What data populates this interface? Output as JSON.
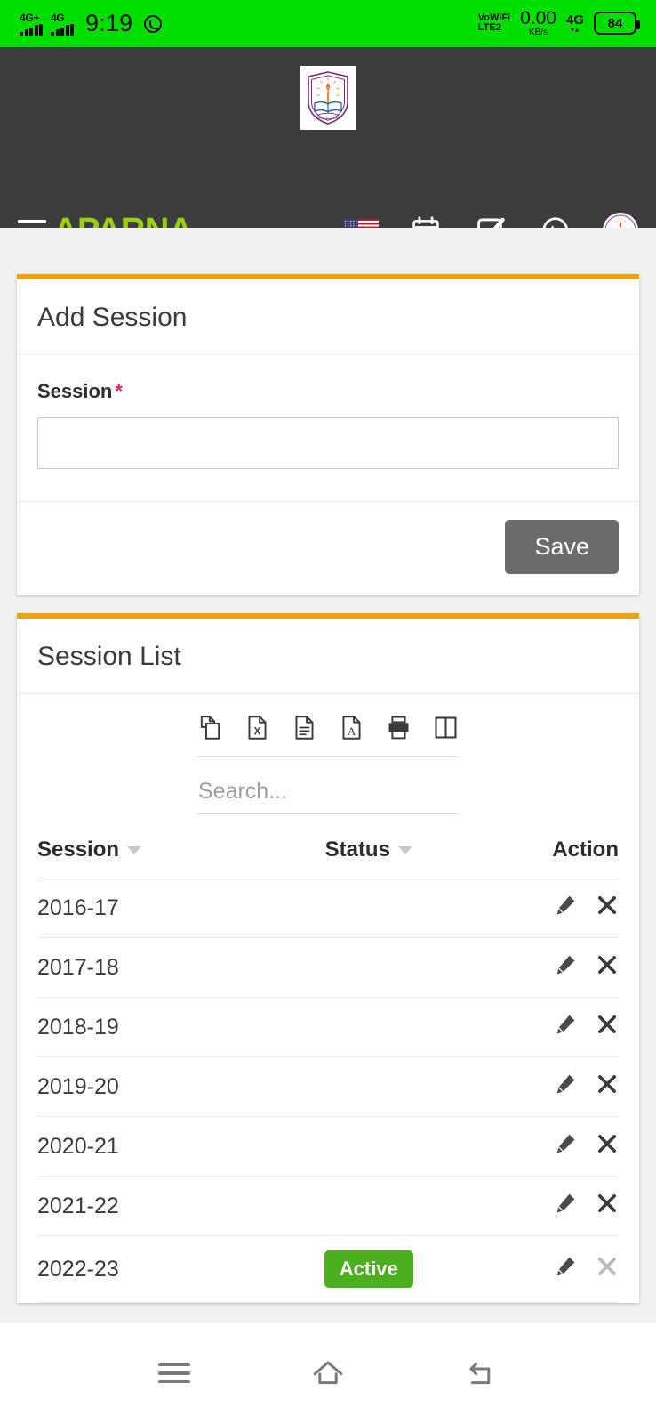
{
  "statusbar": {
    "network_1_label": "4G+",
    "network_2_label": "4G",
    "time": "9:19",
    "whatsapp_icon": "whatsapp-icon",
    "volte_line1": "VoWiFi",
    "volte_line2": "LTE2",
    "data_rate": "0.00",
    "data_rate_unit": "KB/s",
    "network_3_label": "4G",
    "battery_level": "84"
  },
  "header": {
    "brand_title": "APARNA  ...",
    "brand_color": "#9ace12",
    "background_color": "#3d3d3d",
    "menu_icon": "hamburger-menu-icon",
    "logo_alt": "school-crest-logo",
    "nav_icons": [
      {
        "name": "language-flag-icon",
        "label": "US Flag"
      },
      {
        "name": "calendar-icon",
        "label": "Calendar"
      },
      {
        "name": "task-checkbox-icon",
        "label": "Tasks"
      },
      {
        "name": "whatsapp-icon",
        "label": "WhatsApp"
      },
      {
        "name": "user-avatar-icon",
        "label": "Profile"
      }
    ]
  },
  "add_session_card": {
    "accent_color": "#f0a30a",
    "title": "Add Session",
    "field_label": "Session",
    "required_marker": "*",
    "field_value": "",
    "field_placeholder": "",
    "save_label": "Save",
    "save_color": "#6b6b6b"
  },
  "session_list_card": {
    "accent_color": "#f0a30a",
    "title": "Session List",
    "tools": [
      {
        "name": "copy-icon",
        "label": "Copy"
      },
      {
        "name": "excel-export-icon",
        "label": "Excel"
      },
      {
        "name": "csv-export-icon",
        "label": "CSV"
      },
      {
        "name": "pdf-export-icon",
        "label": "PDF"
      },
      {
        "name": "print-icon",
        "label": "Print"
      },
      {
        "name": "column-visibility-icon",
        "label": "Columns"
      }
    ],
    "search_value": "",
    "search_placeholder": "Search...",
    "columns": [
      {
        "key": "session",
        "label": "Session",
        "sortable": true
      },
      {
        "key": "status",
        "label": "Status",
        "sortable": true
      },
      {
        "key": "action",
        "label": "Action",
        "sortable": false
      }
    ],
    "rows": [
      {
        "session": "2016-17",
        "status": "",
        "edit_icon": "edit-pencil-icon",
        "delete_icon": "delete-x-icon",
        "delete_disabled": false
      },
      {
        "session": "2017-18",
        "status": "",
        "edit_icon": "edit-pencil-icon",
        "delete_icon": "delete-x-icon",
        "delete_disabled": false
      },
      {
        "session": "2018-19",
        "status": "",
        "edit_icon": "edit-pencil-icon",
        "delete_icon": "delete-x-icon",
        "delete_disabled": false
      },
      {
        "session": "2019-20",
        "status": "",
        "edit_icon": "edit-pencil-icon",
        "delete_icon": "delete-x-icon",
        "delete_disabled": false
      },
      {
        "session": "2020-21",
        "status": "",
        "edit_icon": "edit-pencil-icon",
        "delete_icon": "delete-x-icon",
        "delete_disabled": false
      },
      {
        "session": "2021-22",
        "status": "",
        "edit_icon": "edit-pencil-icon",
        "delete_icon": "delete-x-icon",
        "delete_disabled": false
      },
      {
        "session": "2022-23",
        "status": "Active",
        "edit_icon": "edit-pencil-icon",
        "delete_icon": "delete-x-icon",
        "delete_disabled": true
      }
    ],
    "active_badge_color": "#4caf1e"
  },
  "android_nav": {
    "recents": "recents-icon",
    "home": "home-icon",
    "back": "back-icon"
  }
}
